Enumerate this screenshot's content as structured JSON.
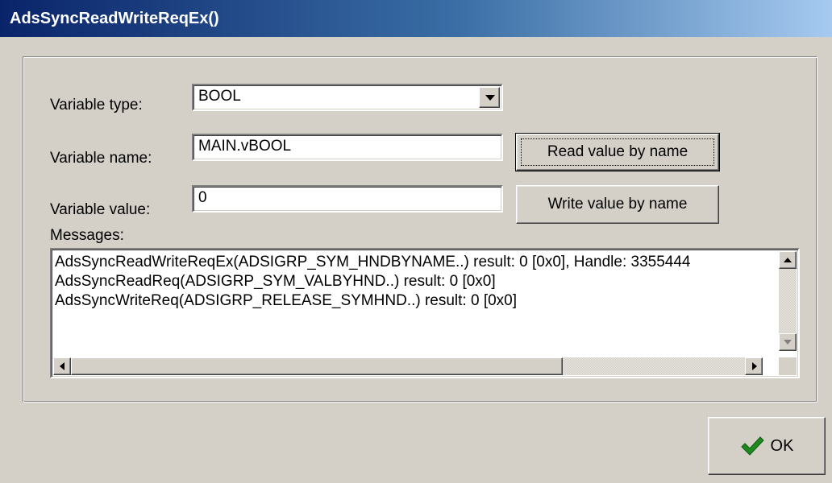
{
  "window": {
    "title": "AdsSyncReadWriteReqEx()"
  },
  "form": {
    "type_label": "Variable type:",
    "type_value": "BOOL",
    "name_label": "Variable name:",
    "name_value": "MAIN.vBOOL",
    "value_label": "Variable value:",
    "value_value": "0",
    "read_button": "Read value by name",
    "write_button": "Write value by name",
    "messages_label": "Messages:"
  },
  "messages": [
    "AdsSyncReadWriteReqEx(ADSIGRP_SYM_HNDBYNAME..) result: 0 [0x0], Handle: 3355444",
    "AdsSyncReadReq(ADSIGRP_SYM_VALBYHND..) result: 0 [0x0]",
    "AdsSyncWriteReq(ADSIGRP_RELEASE_SYMHND..) result: 0 [0x0]"
  ],
  "ok_button": {
    "label": "OK",
    "icon": "checkmark-icon",
    "icon_color": "#1e8a1e"
  },
  "colors": {
    "face": "#d4d0c8",
    "title_start": "#0a246a",
    "title_end": "#a6caf0"
  }
}
